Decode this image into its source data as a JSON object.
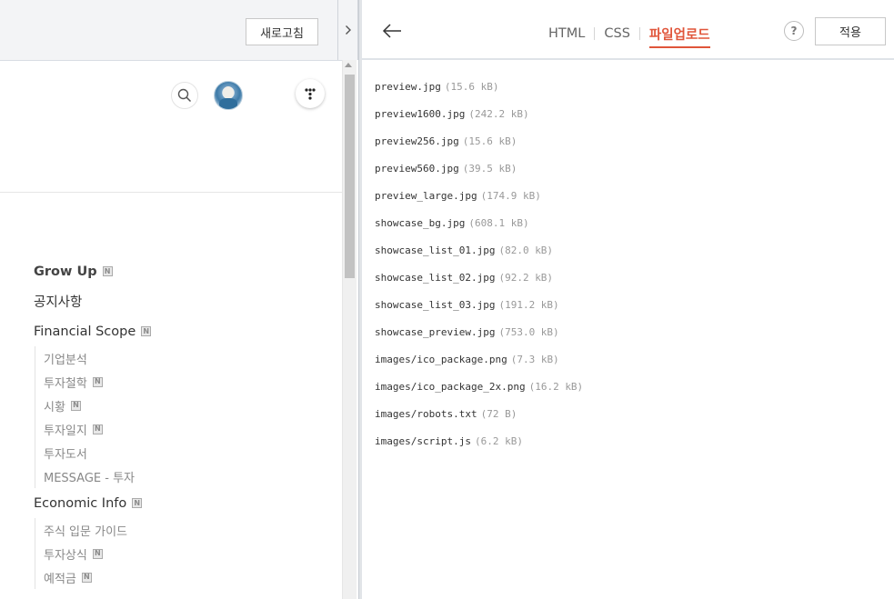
{
  "preview": {
    "refresh_label": "새로고침",
    "menu": [
      {
        "label": "Grow Up",
        "bold": true,
        "new": true,
        "sub": []
      },
      {
        "label": "공지사항",
        "bold": false,
        "new": false,
        "sub": []
      },
      {
        "label": "Financial Scope",
        "bold": false,
        "new": true,
        "sub": [
          {
            "label": "기업분석",
            "new": false
          },
          {
            "label": "투자철학",
            "new": true
          },
          {
            "label": "시황",
            "new": true
          },
          {
            "label": "투자일지",
            "new": true
          },
          {
            "label": "투자도서",
            "new": false
          },
          {
            "label": "MESSAGE - 투자",
            "new": false
          }
        ]
      },
      {
        "label": "Economic Info",
        "bold": false,
        "new": true,
        "sub": [
          {
            "label": "주식 입문 가이드",
            "new": false
          },
          {
            "label": "투자상식",
            "new": true
          },
          {
            "label": "예적금",
            "new": true
          }
        ]
      }
    ],
    "new_badge": "N"
  },
  "editor": {
    "tabs": [
      {
        "label": "HTML",
        "active": false
      },
      {
        "label": "CSS",
        "active": false
      },
      {
        "label": "파일업로드",
        "active": true
      }
    ],
    "help_label": "?",
    "apply_label": "적용",
    "files": [
      {
        "name": "preview.jpg",
        "size": "(15.6 kB)"
      },
      {
        "name": "preview1600.jpg",
        "size": "(242.2 kB)"
      },
      {
        "name": "preview256.jpg",
        "size": "(15.6 kB)"
      },
      {
        "name": "preview560.jpg",
        "size": "(39.5 kB)"
      },
      {
        "name": "preview_large.jpg",
        "size": "(174.9 kB)"
      },
      {
        "name": "showcase_bg.jpg",
        "size": "(608.1 kB)"
      },
      {
        "name": "showcase_list_01.jpg",
        "size": "(82.0 kB)"
      },
      {
        "name": "showcase_list_02.jpg",
        "size": "(92.2 kB)"
      },
      {
        "name": "showcase_list_03.jpg",
        "size": "(191.2 kB)"
      },
      {
        "name": "showcase_preview.jpg",
        "size": "(753.0 kB)"
      },
      {
        "name": "images/ico_package.png",
        "size": "(7.3 kB)"
      },
      {
        "name": "images/ico_package_2x.png",
        "size": "(16.2 kB)"
      },
      {
        "name": "images/robots.txt",
        "size": "(72 B)"
      },
      {
        "name": "images/script.js",
        "size": "(6.2 kB)"
      }
    ]
  },
  "colors": {
    "accent": "#e0553a",
    "topbar_bg": "#f3f4f6"
  }
}
